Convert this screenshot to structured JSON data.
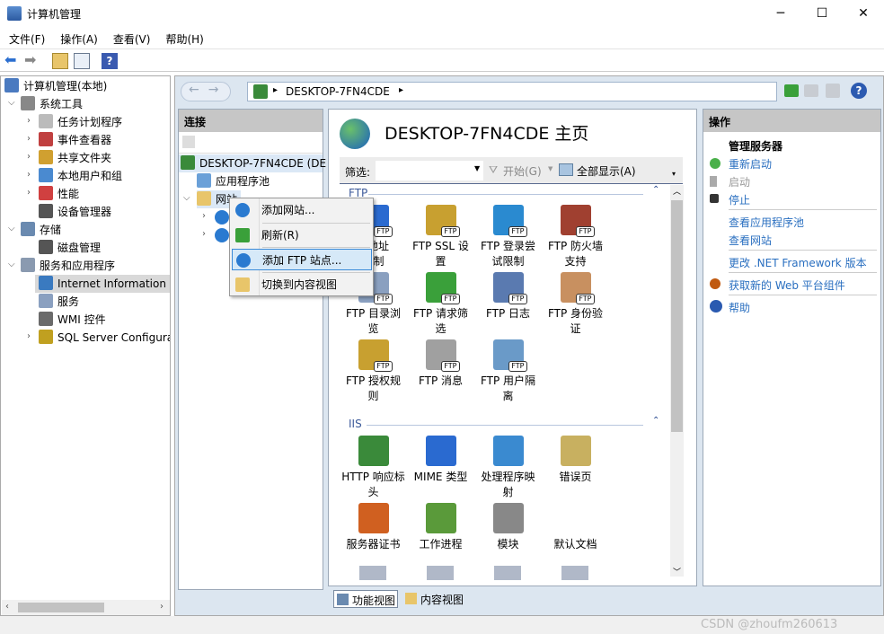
{
  "window": {
    "title": "计算机管理",
    "minimize": "─",
    "maximize": "☐",
    "close": "✕"
  },
  "menu": [
    "文件(F)",
    "操作(A)",
    "查看(V)",
    "帮助(H)"
  ],
  "tree": {
    "root": "计算机管理(本地)",
    "items": [
      {
        "label": "系统工具",
        "level": 1,
        "expanded": true
      },
      {
        "label": "任务计划程序",
        "level": 2
      },
      {
        "label": "事件查看器",
        "level": 2
      },
      {
        "label": "共享文件夹",
        "level": 2
      },
      {
        "label": "本地用户和组",
        "level": 2
      },
      {
        "label": "性能",
        "level": 2
      },
      {
        "label": "设备管理器",
        "level": 2
      },
      {
        "label": "存储",
        "level": 1,
        "expanded": true
      },
      {
        "label": "磁盘管理",
        "level": 2
      },
      {
        "label": "服务和应用程序",
        "level": 1,
        "expanded": true
      },
      {
        "label": "Internet Information S",
        "level": 2,
        "selected": true
      },
      {
        "label": "服务",
        "level": 2
      },
      {
        "label": "WMI 控件",
        "level": 2
      },
      {
        "label": "SQL Server Configura",
        "level": 2
      }
    ]
  },
  "address": {
    "path": "DESKTOP-7FN4CDE",
    "separator": "▸"
  },
  "connections": {
    "title": "连接",
    "server": "DESKTOP-7FN4CDE (DE",
    "app_pools": "应用程序池",
    "sites": "网站"
  },
  "main": {
    "title": "DESKTOP-7FN4CDE 主页",
    "filter_label": "筛选:",
    "filter_value": "",
    "start": "开始(G)",
    "show_all": "全部显示(A)",
    "sections": [
      {
        "name": "FTP",
        "items": [
          "FTP IP 地址和域限制",
          "FTP SSL 设置",
          "FTP 登录尝试限制",
          "FTP 防火墙支持",
          "FTP 目录浏览",
          "FTP 请求筛选",
          "FTP 日志",
          "FTP 身份验证",
          "FTP 授权规则",
          "FTP 消息",
          "FTP 用户隔离"
        ],
        "visible": [
          "P 地址\n限制",
          "FTP SSL 设\n置",
          "FTP 登录尝\n试限制",
          "FTP 防火墙\n支持",
          "FTP 目录浏\n览",
          "FTP 请求筛\n选",
          "FTP 日志",
          "FTP 身份验\n证",
          "FTP 授权规\n则",
          "FTP 消息",
          "FTP 用户隔\n离"
        ]
      },
      {
        "name": "IIS",
        "visible": [
          "HTTP 响应标\n头",
          "MIME 类型",
          "处理程序映\n射",
          "错误页",
          "服务器证书",
          "工作进程",
          "模块",
          "默认文档"
        ]
      }
    ],
    "tabs": [
      "功能视图",
      "内容视图"
    ]
  },
  "actions": {
    "title": "操作",
    "group": "管理服务器",
    "items": [
      "重新启动",
      "启动",
      "停止",
      "查看应用程序池",
      "查看网站",
      "更改 .NET Framework 版本",
      "获取新的 Web 平台组件",
      "帮助"
    ]
  },
  "context_menu": [
    "添加网站...",
    "刷新(R)",
    "添加 FTP 站点...",
    "切换到内容视图"
  ],
  "watermark": "CSDN @zhoufm260613"
}
